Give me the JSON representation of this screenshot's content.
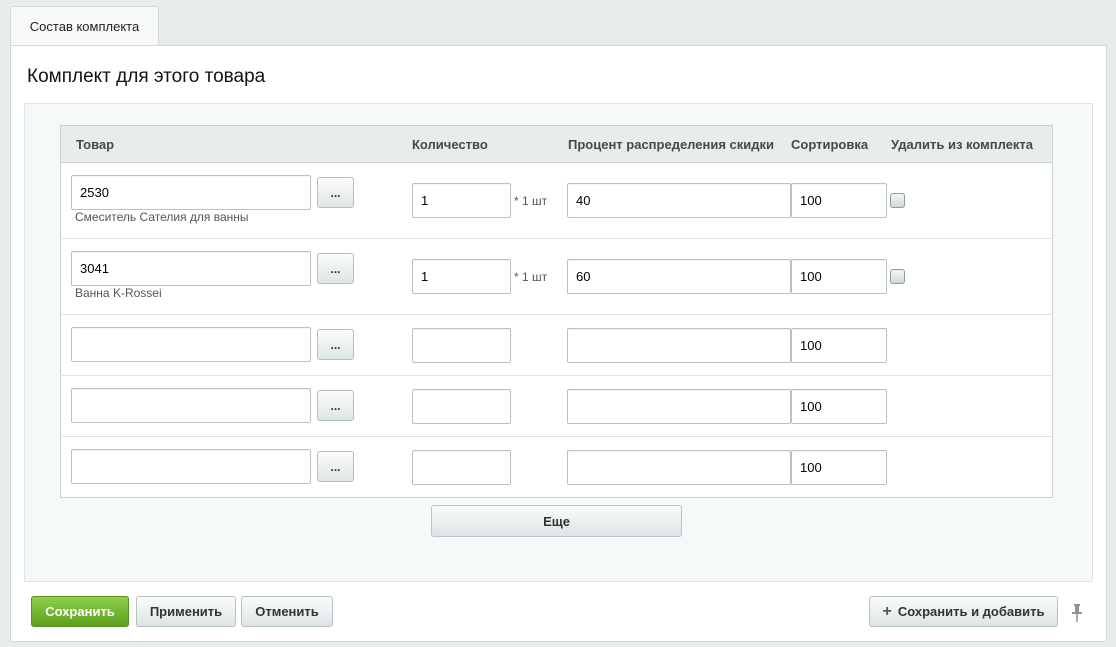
{
  "tabs": [
    {
      "label": "Состав комплекта"
    }
  ],
  "section": {
    "title": "Комплект для этого товара"
  },
  "table": {
    "headers": {
      "product": "Товар",
      "quantity": "Количество",
      "discount_percent": "Процент распределения скидки",
      "sort": "Сортировка",
      "remove": "Удалить из комплекта"
    },
    "pick_button_label": "...",
    "rows": [
      {
        "product_id": "2530",
        "product_name": "Смеситель Сателия для ванны",
        "quantity": "1",
        "unit": "* 1 шт",
        "discount": "40",
        "sort": "100",
        "removable": true
      },
      {
        "product_id": "3041",
        "product_name": "Ванна K-Rossei",
        "quantity": "1",
        "unit": "* 1 шт",
        "discount": "60",
        "sort": "100",
        "removable": true
      },
      {
        "product_id": "",
        "product_name": "",
        "quantity": "",
        "unit": "",
        "discount": "",
        "sort": "100",
        "removable": false
      },
      {
        "product_id": "",
        "product_name": "",
        "quantity": "",
        "unit": "",
        "discount": "",
        "sort": "100",
        "removable": false
      },
      {
        "product_id": "",
        "product_name": "",
        "quantity": "",
        "unit": "",
        "discount": "",
        "sort": "100",
        "removable": false
      }
    ]
  },
  "more_button_label": "Еще",
  "footer": {
    "save_label": "Сохранить",
    "apply_label": "Применить",
    "cancel_label": "Отменить",
    "save_add_label": "Сохранить и добавить"
  },
  "colors": {
    "save_button": "#6cb52a",
    "page_bg": "#e9eced",
    "header_bg": "#e7ecec"
  }
}
